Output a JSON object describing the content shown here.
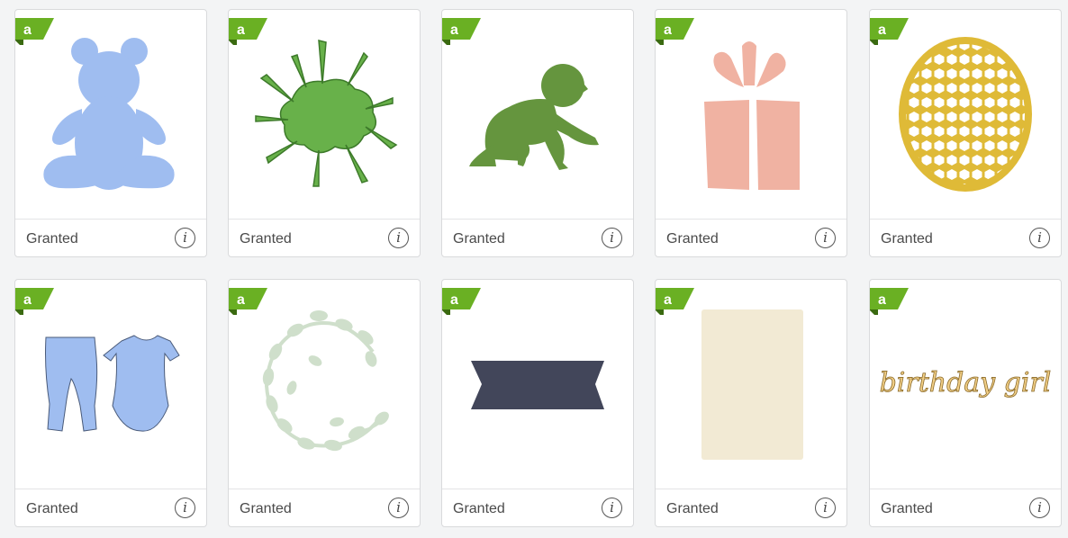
{
  "cards": [
    {
      "image": "teddy-bear",
      "status": "Granted",
      "color": "#9fbdf0"
    },
    {
      "image": "paint-splat",
      "status": "Granted",
      "color": "#68b14a"
    },
    {
      "image": "crawling-baby",
      "status": "Granted",
      "color": "#65953e"
    },
    {
      "image": "gift-box",
      "status": "Granted",
      "color": "#f0b2a2"
    },
    {
      "image": "honeycomb-oval",
      "status": "Granted",
      "color": "#dfba37"
    },
    {
      "image": "baby-clothes",
      "status": "Granted",
      "color": "#9fbdf0"
    },
    {
      "image": "leaf-monogram-c",
      "status": "Granted",
      "color": "#cfdfcb"
    },
    {
      "image": "banner-ribbon",
      "status": "Granted",
      "color": "#42465a"
    },
    {
      "image": "blank-card",
      "status": "Granted",
      "color": "#f2ead4"
    },
    {
      "image": "birthday-girl-text",
      "status": "Granted",
      "color": "#f2cf86",
      "art_text": "birthday girl"
    }
  ],
  "badge": {
    "letter": "a",
    "color": "#6ab023"
  },
  "info_icon": "i"
}
